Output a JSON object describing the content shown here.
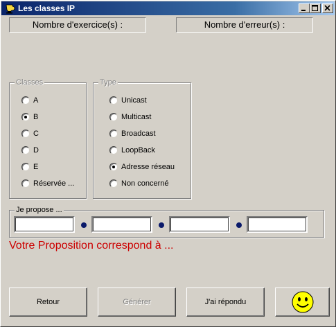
{
  "window": {
    "title": "Les classes IP",
    "app_icon": "cup-icon",
    "controls": [
      "minimize-icon",
      "maximize-icon",
      "close-icon"
    ]
  },
  "counters": {
    "exercises_label": "Nombre d'exercice(s) :",
    "errors_label": "Nombre d'erreur(s) :"
  },
  "classes": {
    "legend": "Classes",
    "options": [
      {
        "label": "A",
        "checked": false
      },
      {
        "label": "B",
        "checked": true
      },
      {
        "label": "C",
        "checked": false
      },
      {
        "label": "D",
        "checked": false
      },
      {
        "label": "E",
        "checked": false
      },
      {
        "label": "Réservée ...",
        "checked": false
      }
    ]
  },
  "type": {
    "legend": "Type",
    "options": [
      {
        "label": "Unicast",
        "checked": false
      },
      {
        "label": "Multicast",
        "checked": false
      },
      {
        "label": "Broadcast",
        "checked": false
      },
      {
        "label": "LoopBack",
        "checked": false
      },
      {
        "label": "Adresse réseau",
        "checked": true
      },
      {
        "label": "Non concerné",
        "checked": false
      }
    ]
  },
  "proposal": {
    "legend": "Je propose ...",
    "octets": [
      "",
      "",
      "",
      ""
    ],
    "separator_color": "#0a1a6a"
  },
  "result_text": "Votre Proposition correspond à  ...",
  "colors": {
    "result_text": "#cc0000",
    "smiley": "#ffff00"
  },
  "buttons": {
    "back": "Retour",
    "generate": "Générer",
    "answered": "J'ai répondu",
    "smiley_icon": "smiley-icon"
  }
}
